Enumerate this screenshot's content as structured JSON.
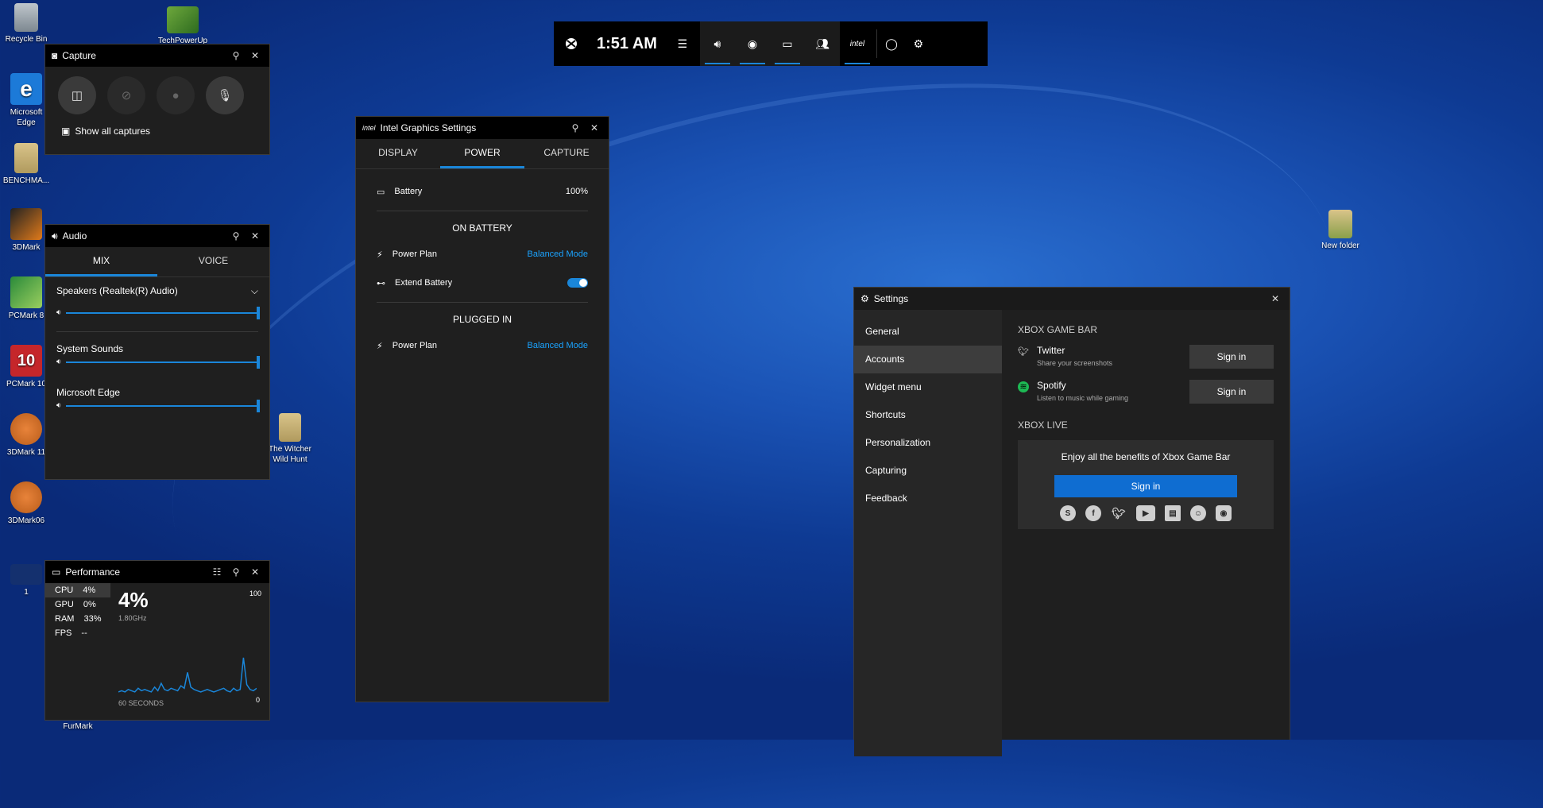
{
  "desktop": {
    "icons": [
      {
        "label": "Recycle Bin"
      },
      {
        "label": "TechPowerUp"
      },
      {
        "label": "Microsoft Edge"
      },
      {
        "label": "BENCHMA..."
      },
      {
        "label": "3DMark"
      },
      {
        "label": "PCMark 8"
      },
      {
        "label": "PCMark 10"
      },
      {
        "label": "3DMark 11"
      },
      {
        "label": "3DMark06"
      },
      {
        "label": "1"
      },
      {
        "label": "FurMark"
      },
      {
        "label": "The Witcher Wild Hunt"
      },
      {
        "label": "New folder"
      }
    ]
  },
  "xbox_bar": {
    "time": "1:51 AM"
  },
  "capture": {
    "title": "Capture",
    "show_all": "Show all captures"
  },
  "audio": {
    "title": "Audio",
    "tabs": [
      "MIX",
      "VOICE"
    ],
    "device": "Speakers (Realtek(R) Audio)",
    "apps": [
      "System Sounds",
      "Microsoft Edge"
    ],
    "levels": {
      "master": 1.0,
      "system_sounds": 1.0,
      "microsoft_edge": 1.0
    }
  },
  "intel": {
    "title": "Intel Graphics Settings",
    "tabs": [
      "DISPLAY",
      "POWER",
      "CAPTURE"
    ],
    "battery_label": "Battery",
    "battery_value": "100%",
    "on_battery": "ON BATTERY",
    "power_plan_label": "Power Plan",
    "power_plan_value": "Balanced Mode",
    "extend_battery": "Extend Battery",
    "plugged_in": "PLUGGED IN",
    "plugged_power_plan_label": "Power Plan",
    "plugged_power_plan_value": "Balanced Mode"
  },
  "performance": {
    "title": "Performance",
    "items": [
      {
        "name": "CPU",
        "value": "4%"
      },
      {
        "name": "GPU",
        "value": "0%"
      },
      {
        "name": "RAM",
        "value": "33%"
      },
      {
        "name": "FPS",
        "value": "--"
      }
    ],
    "big_value": "4%",
    "freq": "1.80GHz",
    "max": "100",
    "min": "0",
    "span": "60 SECONDS",
    "graph": [
      2,
      3,
      2,
      4,
      3,
      2,
      5,
      3,
      4,
      3,
      2,
      6,
      3,
      9,
      4,
      3,
      5,
      4,
      3,
      7,
      5,
      18,
      6,
      4,
      3,
      2,
      3,
      4,
      3,
      2,
      3,
      4,
      5,
      3,
      2,
      5,
      3,
      4,
      30,
      8,
      4,
      3,
      5
    ]
  },
  "settings": {
    "title": "Settings",
    "nav": [
      "General",
      "Accounts",
      "Widget menu",
      "Shortcuts",
      "Personalization",
      "Capturing",
      "Feedback"
    ],
    "section_gamebar": "XBOX GAME BAR",
    "twitter": {
      "name": "Twitter",
      "sub": "Share your screenshots",
      "button": "Sign in"
    },
    "spotify": {
      "name": "Spotify",
      "sub": "Listen to music while gaming",
      "button": "Sign in"
    },
    "section_live": "XBOX LIVE",
    "live_text": "Enjoy all the benefits of Xbox Game Bar",
    "live_button": "Sign in"
  }
}
